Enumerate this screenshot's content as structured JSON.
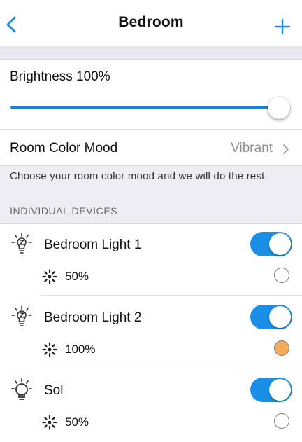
{
  "nav": {
    "back_icon": "chevron-left-icon",
    "title": "Bedroom",
    "add_icon": "plus-icon"
  },
  "brightness": {
    "label": "Brightness 100%",
    "value": 1.0
  },
  "mood": {
    "label": "Room Color Mood",
    "value": "Vibrant",
    "chevron_icon": "chevron-right-icon"
  },
  "hint": "Choose your room color mood and we will do the rest.",
  "section_header": "INDIVIDUAL DEVICES",
  "colors": {
    "accent": "#1b8ee8",
    "slider": "#1d7fd3",
    "color_dot_orange": "#f5ac5a",
    "grey_band": "#eeedf3"
  },
  "devices": [
    {
      "name": "Bedroom Light 1",
      "icon": "lightbulb-icon",
      "on": true,
      "level": "50%",
      "level_icon": "brightness-icon",
      "color": null
    },
    {
      "name": "Bedroom Light 2",
      "icon": "lightbulb-icon",
      "on": true,
      "level": "100%",
      "level_icon": "brightness-icon",
      "color": "#f5ac5a"
    },
    {
      "name": "Sol",
      "icon": "lamp-bulb-icon",
      "on": true,
      "level": "50%",
      "level_icon": "brightness-icon",
      "color": null
    }
  ]
}
